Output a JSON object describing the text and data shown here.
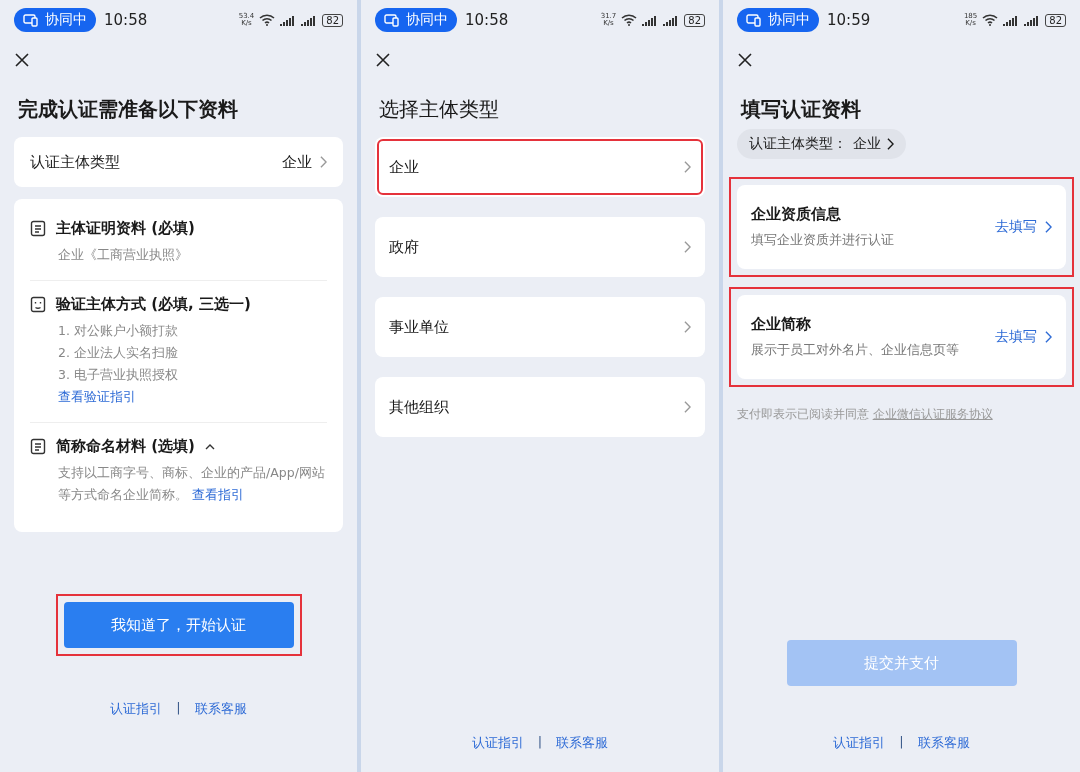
{
  "screens": [
    {
      "kind": "requirements",
      "status_bar": {
        "badge": "协同中",
        "time": "10:58",
        "speed": "53.4",
        "speed_unit": "K/s",
        "battery": "82"
      },
      "title": "完成认证需准备以下资料",
      "type_row": {
        "label": "认证主体类型",
        "value": "企业"
      },
      "sections": [
        {
          "kind": "document",
          "title": "主体证明资料 (必填)",
          "lines": [
            "企业《工商营业执照》"
          ]
        },
        {
          "kind": "verify",
          "title": "验证主体方式 (必填, 三选一)",
          "lines": [
            "1. 对公账户小额打款",
            "2. 企业法人实名扫脸",
            "3. 电子营业执照授权"
          ],
          "link": "查看验证指引"
        },
        {
          "kind": "document",
          "title": "简称命名材料 (选填)",
          "expanded": true,
          "text": "支持以工商字号、商标、企业的产品/App/网站等方式命名企业简称。",
          "inline_link": "查看指引"
        }
      ],
      "primary_button": {
        "label": "我知道了，开始认证",
        "highlighted": true,
        "disabled": false
      },
      "footer": {
        "links": [
          "认证指引",
          "联系客服"
        ],
        "separator": "|"
      }
    },
    {
      "kind": "choose",
      "status_bar": {
        "badge": "协同中",
        "time": "10:58",
        "speed": "31.7",
        "speed_unit": "K/s",
        "battery": "82"
      },
      "title": "选择主体类型",
      "options": [
        {
          "label": "企业",
          "highlighted": true
        },
        {
          "label": "政府",
          "highlighted": false
        },
        {
          "label": "事业单位",
          "highlighted": false
        },
        {
          "label": "其他组织",
          "highlighted": false
        }
      ],
      "footer": {
        "links": [
          "认证指引",
          "联系客服"
        ],
        "separator": "|"
      }
    },
    {
      "kind": "fill",
      "status_bar": {
        "badge": "协同中",
        "time": "10:59",
        "speed": "185",
        "speed_unit": "K/s",
        "battery": "82"
      },
      "title": "填写认证资料",
      "chip": {
        "label": "认证主体类型：",
        "value": "企业"
      },
      "cards": [
        {
          "title": "企业资质信息",
          "subtitle": "填写企业资质并进行认证",
          "action": "去填写",
          "highlighted": true
        },
        {
          "title": "企业简称",
          "subtitle": "展示于员工对外名片、企业信息页等",
          "action": "去填写",
          "highlighted": true
        }
      ],
      "agreement": {
        "text": "支付即表示已阅读并同意",
        "link": "企业微信认证服务协议"
      },
      "primary_button": {
        "label": "提交并支付",
        "disabled": true
      },
      "footer": {
        "links": [
          "认证指引",
          "联系客服"
        ],
        "separator": "|"
      }
    }
  ]
}
